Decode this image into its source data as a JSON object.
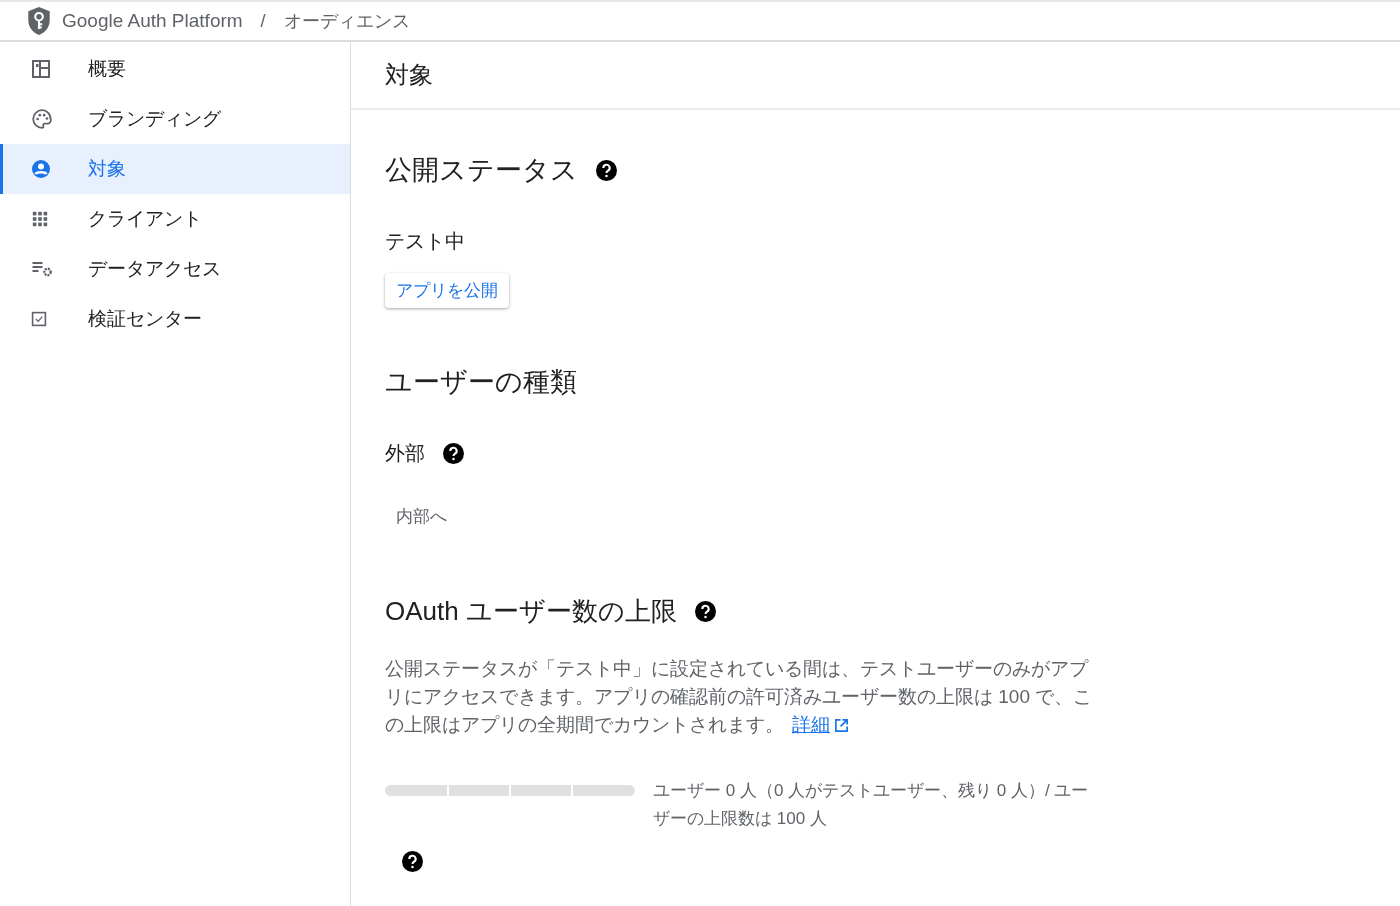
{
  "header": {
    "product": "Google Auth Platform",
    "separator": "/",
    "page": "オーディエンス"
  },
  "sidebar": {
    "items": [
      {
        "label": "概要",
        "kind": "dashboard",
        "selected": false
      },
      {
        "label": "ブランディング",
        "kind": "palette",
        "selected": false
      },
      {
        "label": "対象",
        "kind": "person",
        "selected": true
      },
      {
        "label": "クライアント",
        "kind": "grid",
        "selected": false
      },
      {
        "label": "データアクセス",
        "kind": "settings-list",
        "selected": false
      },
      {
        "label": "検証センター",
        "kind": "checkbox",
        "selected": false
      }
    ]
  },
  "main": {
    "title": "対象",
    "publishing_status": {
      "heading": "公開ステータス",
      "status": "テスト中",
      "button": "アプリを公開"
    },
    "user_type": {
      "heading": "ユーザーの種類",
      "value": "外部",
      "button": "内部へ"
    },
    "user_cap": {
      "heading": "OAuth ユーザー数の上限",
      "description": "公開ステータスが「テスト中」に設定されている間は、テストユーザーのみがアプリにアクセスできます。アプリの確認前の許可済みユーザー数の上限は 100 で、この上限はアプリの全期間でカウントされます。",
      "link": "詳細",
      "level": 0,
      "reading": "ユーザー 0 人（0 人がテストユーザー、残り 0 人）/ ユーザーの上限数は 100 人"
    }
  }
}
